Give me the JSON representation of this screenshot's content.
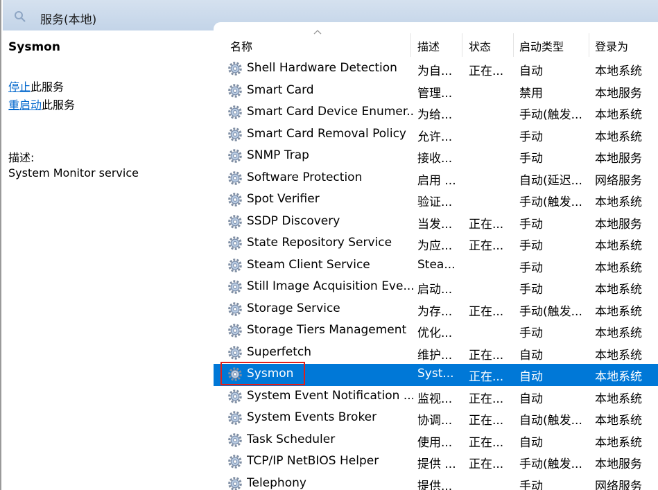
{
  "window": {
    "title": "服务(本地)"
  },
  "left_panel": {
    "service_name": "Sysmon",
    "stop_link": "停止",
    "stop_suffix": "此服务",
    "restart_link": "重启动",
    "restart_suffix": "此服务",
    "description_label": "描述:",
    "description_text": "System Monitor service"
  },
  "columns": {
    "name": "名称",
    "description": "描述",
    "status": "状态",
    "startup_type": "启动类型",
    "logon_as": "登录为"
  },
  "services": [
    {
      "name": "Shell Hardware Detection",
      "description": "为自...",
      "status": "正在...",
      "startup": "自动",
      "logon": "本地系统"
    },
    {
      "name": "Smart Card",
      "description": "管理...",
      "status": "",
      "startup": "禁用",
      "logon": "本地服务"
    },
    {
      "name": "Smart Card Device Enumer...",
      "description": "为给...",
      "status": "",
      "startup": "手动(触发...",
      "logon": "本地系统"
    },
    {
      "name": "Smart Card Removal Policy",
      "description": "允许...",
      "status": "",
      "startup": "手动",
      "logon": "本地系统"
    },
    {
      "name": "SNMP Trap",
      "description": "接收...",
      "status": "",
      "startup": "手动",
      "logon": "本地服务"
    },
    {
      "name": "Software Protection",
      "description": "启用 ...",
      "status": "",
      "startup": "自动(延迟...",
      "logon": "网络服务"
    },
    {
      "name": "Spot Verifier",
      "description": "验证...",
      "status": "",
      "startup": "手动(触发...",
      "logon": "本地系统"
    },
    {
      "name": "SSDP Discovery",
      "description": "当发...",
      "status": "正在...",
      "startup": "手动",
      "logon": "本地服务"
    },
    {
      "name": "State Repository Service",
      "description": "为应...",
      "status": "正在...",
      "startup": "手动",
      "logon": "本地系统"
    },
    {
      "name": "Steam Client Service",
      "description": "Stea...",
      "status": "",
      "startup": "手动",
      "logon": "本地系统"
    },
    {
      "name": "Still Image Acquisition Eve...",
      "description": "启动...",
      "status": "",
      "startup": "手动",
      "logon": "本地系统"
    },
    {
      "name": "Storage Service",
      "description": "为存...",
      "status": "正在...",
      "startup": "手动(触发...",
      "logon": "本地系统"
    },
    {
      "name": "Storage Tiers Management",
      "description": "优化...",
      "status": "",
      "startup": "手动",
      "logon": "本地系统"
    },
    {
      "name": "Superfetch",
      "description": "维护...",
      "status": "正在...",
      "startup": "自动",
      "logon": "本地系统"
    },
    {
      "name": "Sysmon",
      "description": "Syst...",
      "status": "正在...",
      "startup": "自动",
      "logon": "本地系统"
    },
    {
      "name": "System Event Notification ...",
      "description": "监视...",
      "status": "正在...",
      "startup": "自动",
      "logon": "本地系统"
    },
    {
      "name": "System Events Broker",
      "description": "协调...",
      "status": "正在...",
      "startup": "自动(触发...",
      "logon": "本地系统"
    },
    {
      "name": "Task Scheduler",
      "description": "使用...",
      "status": "正在...",
      "startup": "自动",
      "logon": "本地系统"
    },
    {
      "name": "TCP/IP NetBIOS Helper",
      "description": "提供 ...",
      "status": "正在...",
      "startup": "手动(触发...",
      "logon": "本地服务"
    },
    {
      "name": "Telephony",
      "description": "提供...",
      "status": "",
      "startup": "手动",
      "logon": "网络服务"
    }
  ],
  "selected_service": "Sysmon",
  "colors": {
    "selection": "#0078d7",
    "link": "#0066cc",
    "highlight_box": "#e0201b",
    "titlebar": "#c9d9ec"
  },
  "icons": {
    "title": "search-icon",
    "service": "gear-icon",
    "sort": "sort-ascending-icon"
  }
}
